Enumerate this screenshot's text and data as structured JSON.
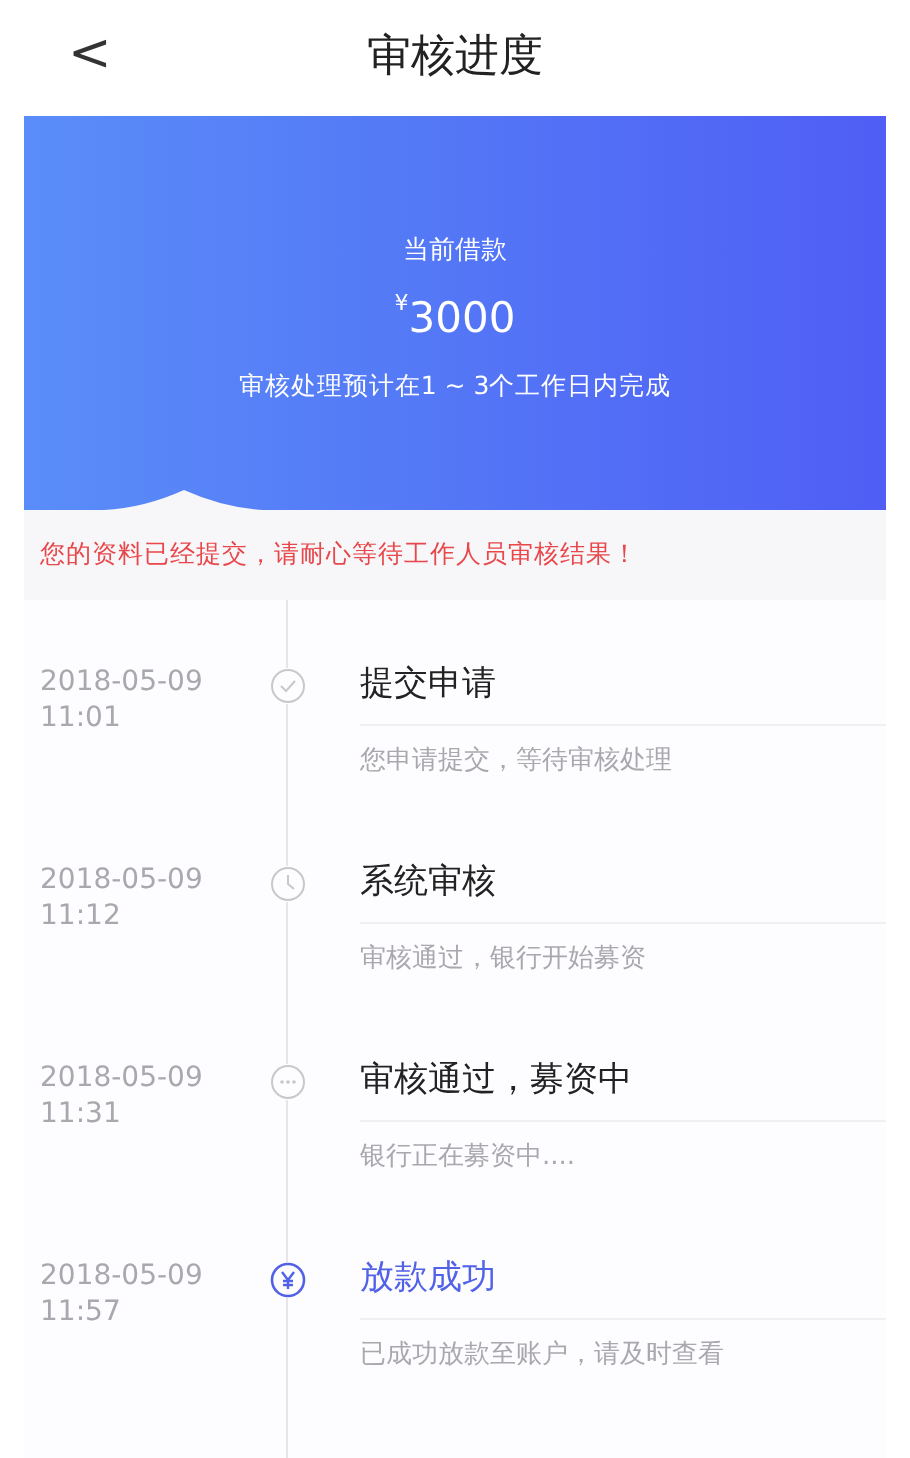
{
  "header": {
    "back": "<",
    "title": "审核进度"
  },
  "banner": {
    "label": "当前借款",
    "currency": "¥",
    "amount": "3000",
    "note": "审核处理预计在1 ~ 3个工作日内完成"
  },
  "notice": "您的资料已经提交，请耐心等待工作人员审核结果！",
  "steps": [
    {
      "date": "2018-05-09",
      "time": "11:01",
      "kind": "check",
      "title": "提交申请",
      "desc": "您申请提交，等待审核处理",
      "current": false
    },
    {
      "date": "2018-05-09",
      "time": "11:12",
      "kind": "clock",
      "title": "系统审核",
      "desc": "审核通过，银行开始募资",
      "current": false
    },
    {
      "date": "2018-05-09",
      "time": "11:31",
      "kind": "dots",
      "title": "审核通过，募资中",
      "desc": "银行正在募资中....",
      "current": false
    },
    {
      "date": "2018-05-09",
      "time": "11:57",
      "kind": "yen",
      "title": "放款成功",
      "desc": "已成功放款至账户，请及时查看",
      "current": true
    }
  ]
}
